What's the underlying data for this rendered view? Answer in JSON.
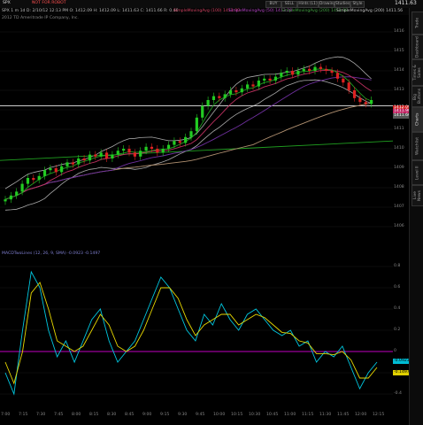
{
  "topbar": {
    "symbol": "SPX",
    "sym_status": "NOT FOR ROBOT",
    "price": "1411.63",
    "buttons": [
      "Drawings",
      "Studies",
      "Style"
    ],
    "other_buttons": [
      "BUY",
      "SELL",
      "Hints (L1)",
      "lim"
    ]
  },
  "infobar": {
    "text": "SPX  1 m 1d  D: 2/10/12 12:13 PM  O: 1412.09  H: 1412.09  L: 1411.63  C: 1411.66  R: 0.46",
    "studies": [
      "SimpleMovingAvg (100) 1411.90",
      "SimpleMovingAvg (50) 1413.28",
      "SimpleMovingAvg (200) 1411.98",
      "SimpleMovingAvg (100) 1401.00",
      "SimpleMovingAvg (200) 1411.56"
    ],
    "copyright": "2012 TD Ameritrade IP Company, Inc."
  },
  "price_axis": [
    "1416",
    "1415",
    "1414",
    "1413",
    "1412",
    "1411",
    "1410",
    "1409",
    "1408",
    "1407",
    "1406"
  ],
  "price_tags": [
    {
      "value": "1412.09",
      "color": "#d02020"
    },
    {
      "value": "1411.90",
      "color": "#c02060"
    },
    {
      "value": "1411.66",
      "color": "#555555"
    }
  ],
  "macd": {
    "title": "MACDTwoLines (12, 26, 9, SMA)  -0.0923  -0.1497",
    "axis": [
      "0.8",
      "0.6",
      "0.4",
      "0.2",
      "0",
      "-0.2",
      "-0.4"
    ],
    "tags": [
      {
        "value": "-0.0923",
        "color": "#00bcd4"
      },
      {
        "value": "-0.1497",
        "color": "#e0d000"
      }
    ]
  },
  "time_axis": [
    "7:00",
    "7:15",
    "7:30",
    "7:45",
    "8:00",
    "8:15",
    "8:30",
    "8:45",
    "9:00",
    "9:15",
    "9:30",
    "9:45",
    "10:00",
    "10:15",
    "10:30",
    "10:45",
    "11:00",
    "11:15",
    "11:30",
    "11:45",
    "12:00",
    "12:15"
  ],
  "side_tabs": [
    "Live News",
    "Level II",
    "Watchlist",
    "Charts",
    "Big Buttons",
    "Times & Sales",
    "Dashboard",
    "Trade"
  ],
  "colors": {
    "up": "#22cc22",
    "down": "#dd2222",
    "band": "#aaaaaa",
    "ma_red": "#c03060",
    "ma_purple": "#7030a0",
    "ma_green": "#20a020",
    "ma_white": "#d8d8d8",
    "macd": "#00c8e0",
    "signal": "#e8d800",
    "zero": "#c000c0"
  },
  "chart_data": [
    {
      "type": "candlestick",
      "title": "SPX 1 m",
      "y_range": [
        1405.5,
        1416.5
      ],
      "close": [
        1407.4,
        1407.6,
        1407.8,
        1408.2,
        1408.5,
        1408.4,
        1408.6,
        1408.9,
        1409.0,
        1408.8,
        1409.1,
        1409.3,
        1409.2,
        1409.5,
        1409.4,
        1409.7,
        1409.6,
        1409.8,
        1409.5,
        1409.7,
        1409.9,
        1410.0,
        1409.8,
        1409.6,
        1409.9,
        1410.1,
        1410.0,
        1409.8,
        1410.0,
        1410.2,
        1410.4,
        1410.3,
        1410.6,
        1410.9,
        1411.6,
        1412.2,
        1412.5,
        1412.7,
        1412.6,
        1412.8,
        1413.0,
        1412.9,
        1413.1,
        1413.3,
        1413.2,
        1413.5,
        1413.6,
        1413.5,
        1413.7,
        1413.9,
        1414.0,
        1413.8,
        1414.0,
        1414.1,
        1414.0,
        1414.2,
        1414.1,
        1414.0,
        1413.9,
        1413.6,
        1413.4,
        1413.0,
        1412.6,
        1412.4,
        1412.3,
        1412.5
      ]
    },
    {
      "type": "line",
      "title": "MACDTwoLines (12, 26, 9, SMA)",
      "y_range": [
        -0.5,
        0.9
      ],
      "series": [
        {
          "name": "Value",
          "values": [
            -0.2,
            -0.4,
            0.2,
            0.75,
            0.6,
            0.2,
            -0.05,
            0.1,
            -0.1,
            0.1,
            0.3,
            0.4,
            0.1,
            -0.1,
            0.0,
            0.1,
            0.3,
            0.5,
            0.7,
            0.6,
            0.4,
            0.2,
            0.1,
            0.35,
            0.25,
            0.45,
            0.3,
            0.2,
            0.35,
            0.4,
            0.3,
            0.2,
            0.15,
            0.2,
            0.05,
            0.1,
            -0.1,
            0.0,
            -0.05,
            0.05,
            -0.15,
            -0.35,
            -0.2,
            -0.1
          ]
        },
        {
          "name": "Avg",
          "values": [
            -0.1,
            -0.3,
            0.0,
            0.55,
            0.65,
            0.4,
            0.1,
            0.05,
            0.0,
            0.05,
            0.2,
            0.35,
            0.25,
            0.05,
            0.0,
            0.05,
            0.2,
            0.4,
            0.6,
            0.6,
            0.5,
            0.3,
            0.15,
            0.25,
            0.3,
            0.35,
            0.35,
            0.25,
            0.3,
            0.35,
            0.32,
            0.25,
            0.18,
            0.17,
            0.1,
            0.08,
            -0.02,
            -0.02,
            -0.03,
            0.0,
            -0.08,
            -0.25,
            -0.25,
            -0.15
          ]
        }
      ]
    }
  ]
}
